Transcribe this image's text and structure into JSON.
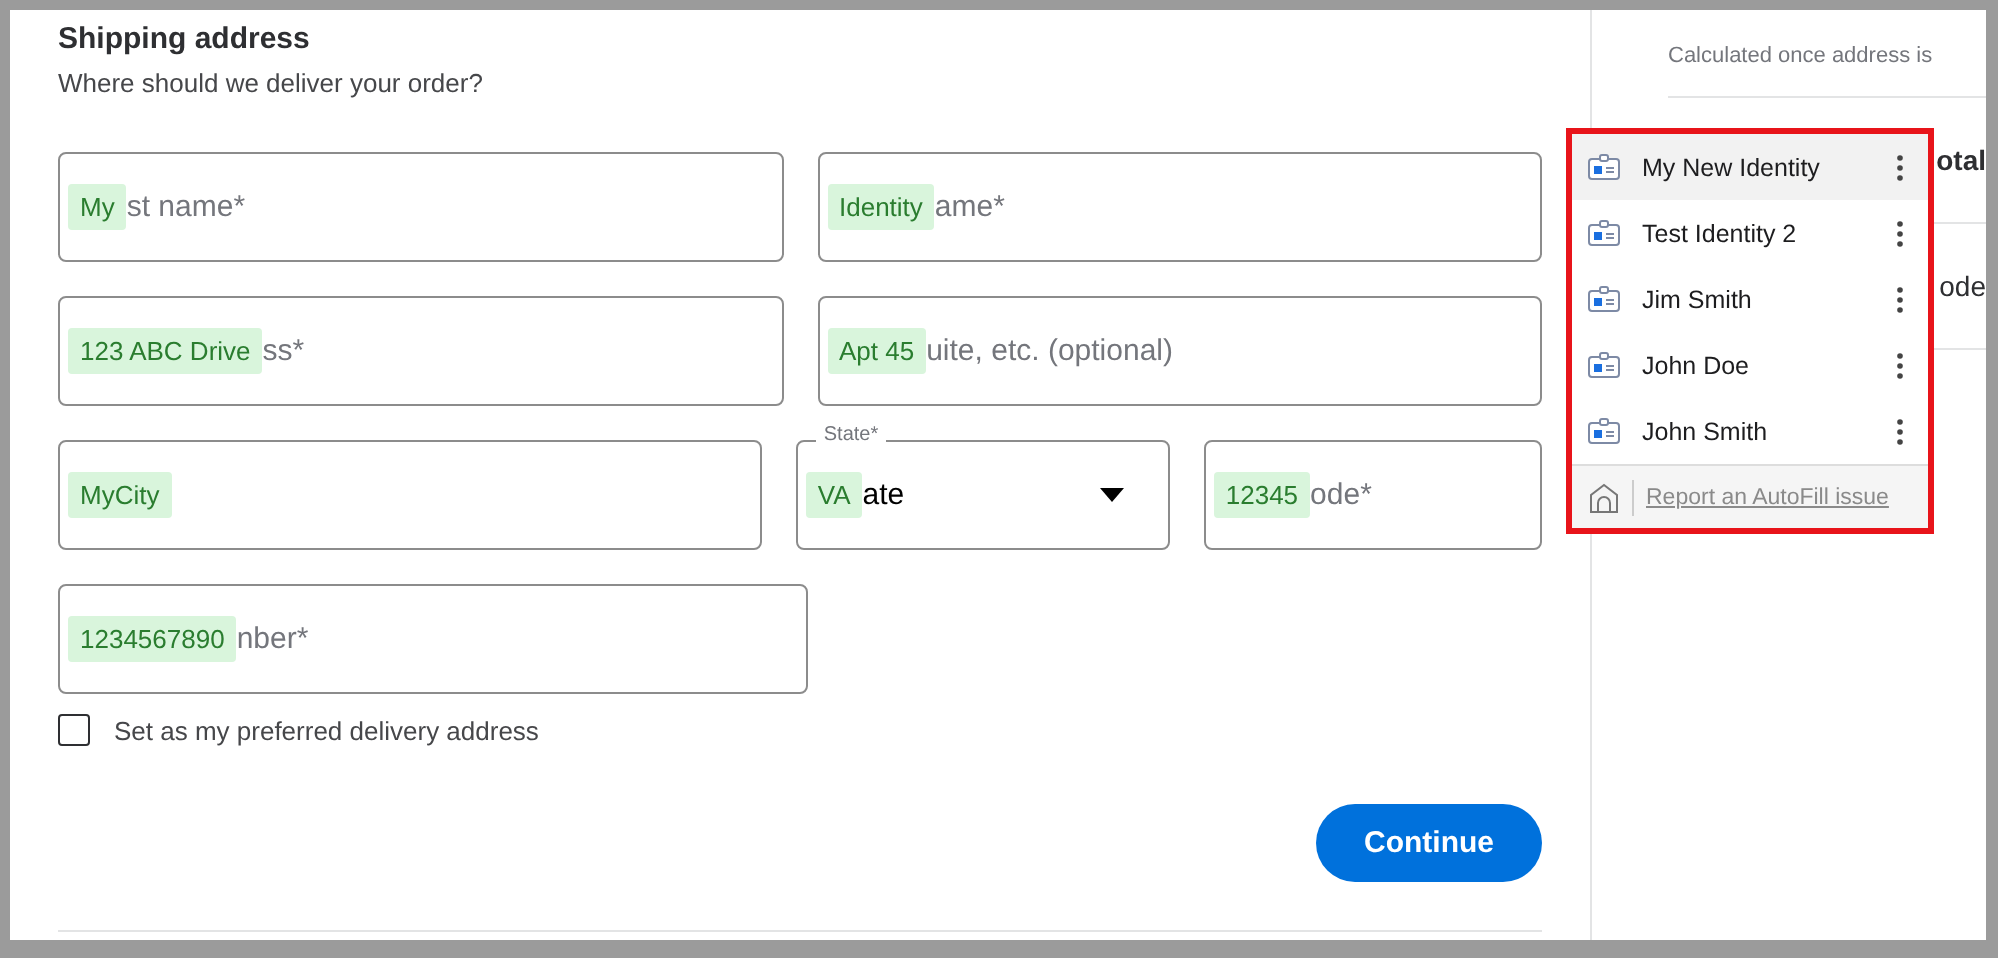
{
  "shipping": {
    "title": "Shipping address",
    "subtitle": "Where should we deliver your order?",
    "rows": [
      [
        {
          "kind": "text",
          "value": "My",
          "placeholder": "st name*"
        },
        {
          "kind": "text",
          "value": "Identity",
          "placeholder": "ame*"
        }
      ],
      [
        {
          "kind": "text",
          "value": "123 ABC Drive",
          "placeholder": "ss*"
        },
        {
          "kind": "text",
          "value": "Apt 45",
          "placeholder": "uite, etc. (optional)"
        }
      ],
      [
        {
          "kind": "text",
          "value": "MyCity"
        },
        {
          "kind": "select",
          "label": "State*",
          "value": "VA",
          "text": "ate"
        },
        {
          "kind": "text",
          "value": "12345",
          "placeholder": "ode*"
        }
      ],
      [
        {
          "kind": "text",
          "value": "1234567890",
          "placeholder": "nber*"
        }
      ]
    ],
    "preferred": {
      "label": "Set as my preferred delivery address",
      "checked": false
    },
    "continue_button": "Continue"
  },
  "summary": {
    "taxes_note": "Calculated once address is",
    "total_fragment": "otal",
    "code_fragment": "ode"
  },
  "autofill": {
    "items": [
      {
        "name": "My New Identity",
        "selected": true
      },
      {
        "name": "Test Identity 2",
        "selected": false
      },
      {
        "name": "Jim Smith",
        "selected": false
      },
      {
        "name": "John Doe",
        "selected": false
      },
      {
        "name": "John Smith",
        "selected": false
      }
    ],
    "report_link": "Report an AutoFill issue"
  }
}
